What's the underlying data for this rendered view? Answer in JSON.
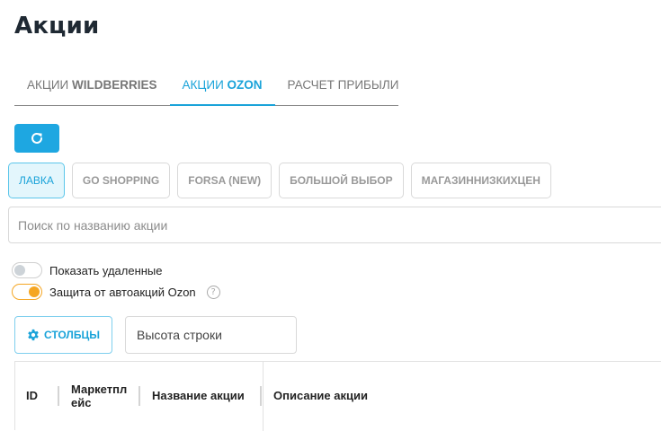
{
  "page": {
    "title": "Акции"
  },
  "tabs": [
    {
      "prefix": "АКЦИИ ",
      "bold": "WILDBERRIES",
      "active": false
    },
    {
      "prefix": "АКЦИИ ",
      "bold": "OZON",
      "active": true
    },
    {
      "prefix": "РАСЧЕТ ПРИБЫЛИ",
      "bold": "",
      "active": false
    }
  ],
  "toolbar": {
    "refresh_icon": "refresh-icon"
  },
  "stores": [
    "ЛАВКА",
    "GO SHOPPING",
    "FORSA (NEW)",
    "БОЛЬШОЙ ВЫБОР",
    "МАГАЗИННИЗКИХЦЕН"
  ],
  "search": {
    "placeholder": "Поиск по названию акции",
    "value": ""
  },
  "toggles": {
    "show_deleted": {
      "label": "Показать удаленные",
      "on": false
    },
    "auto_protect": {
      "label": "Защита от автоакций Ozon",
      "on": true,
      "help_icon": "question-circle-icon"
    }
  },
  "columns_button": {
    "label": "СТОЛБЦЫ",
    "icon": "gear-icon"
  },
  "row_height": {
    "label": "Высота строки"
  },
  "table": {
    "headers": {
      "id": "ID",
      "marketplace_line1": "Маркетпл",
      "marketplace_line2": "ейс",
      "name": "Название акции",
      "description": "Описание акции"
    }
  },
  "colors": {
    "accent": "#1ea7e1",
    "toggle_on": "#f5a623",
    "title": "#1f2933"
  }
}
